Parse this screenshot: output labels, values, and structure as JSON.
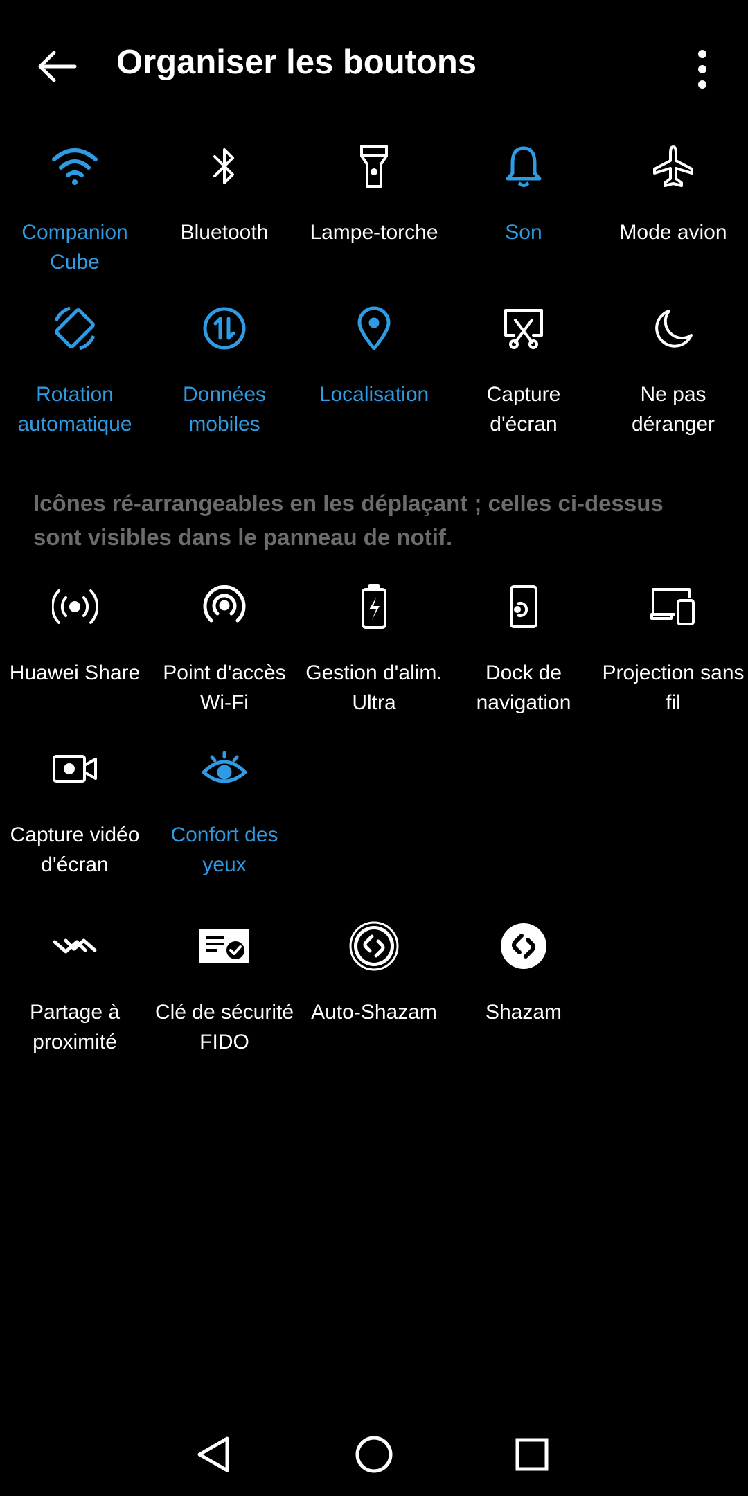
{
  "header": {
    "title": "Organiser les boutons"
  },
  "active_tiles": [
    {
      "label": "Companion Cube",
      "icon": "wifi-icon",
      "on": true
    },
    {
      "label": "Bluetooth",
      "icon": "bluetooth-icon",
      "on": false
    },
    {
      "label": "Lampe-torche",
      "icon": "flashlight-icon",
      "on": false
    },
    {
      "label": "Son",
      "icon": "bell-icon",
      "on": true
    },
    {
      "label": "Mode avion",
      "icon": "airplane-icon",
      "on": false
    },
    {
      "label": "Rotation automatique",
      "icon": "auto-rotate-icon",
      "on": true
    },
    {
      "label": "Données mobiles",
      "icon": "mobile-data-icon",
      "on": true
    },
    {
      "label": "Localisation",
      "icon": "location-icon",
      "on": true
    },
    {
      "label": "Capture d'écran",
      "icon": "screenshot-icon",
      "on": false
    },
    {
      "label": "Ne pas déranger",
      "icon": "moon-icon",
      "on": false
    }
  ],
  "note": "Icônes ré-arrangeables en les déplaçant ; celles ci-dessus sont visibles dans le panneau de notif.",
  "inactive_tiles": [
    {
      "label": "Huawei Share",
      "icon": "huawei-share-icon",
      "on": false
    },
    {
      "label": "Point d'accès Wi-Fi",
      "icon": "hotspot-icon",
      "on": false
    },
    {
      "label": "Gestion d'alim. Ultra",
      "icon": "battery-saver-icon",
      "on": false
    },
    {
      "label": "Dock de navigation",
      "icon": "navigation-dock-icon",
      "on": false
    },
    {
      "label": "Projection sans fil",
      "icon": "wireless-projection-icon",
      "on": false
    },
    {
      "label": "Capture vidéo d'écran",
      "icon": "screen-record-icon",
      "on": false
    },
    {
      "label": "Confort des yeux",
      "icon": "eye-comfort-icon",
      "on": true
    }
  ],
  "app_tiles": [
    {
      "label": "Partage à proximité",
      "icon": "nearby-share-icon",
      "on": false
    },
    {
      "label": "Clé de sécurité FIDO",
      "icon": "fido-key-icon",
      "on": false
    },
    {
      "label": "Auto-Shazam",
      "icon": "auto-shazam-icon",
      "on": false
    },
    {
      "label": "Shazam",
      "icon": "shazam-icon",
      "on": false
    }
  ],
  "colors": {
    "accent": "#2f9be2",
    "text": "#ffffff",
    "note": "#6c6c6c",
    "background": "#000000"
  },
  "navbar": {
    "icons": [
      "nav-back-icon",
      "nav-home-icon",
      "nav-recents-icon"
    ]
  }
}
